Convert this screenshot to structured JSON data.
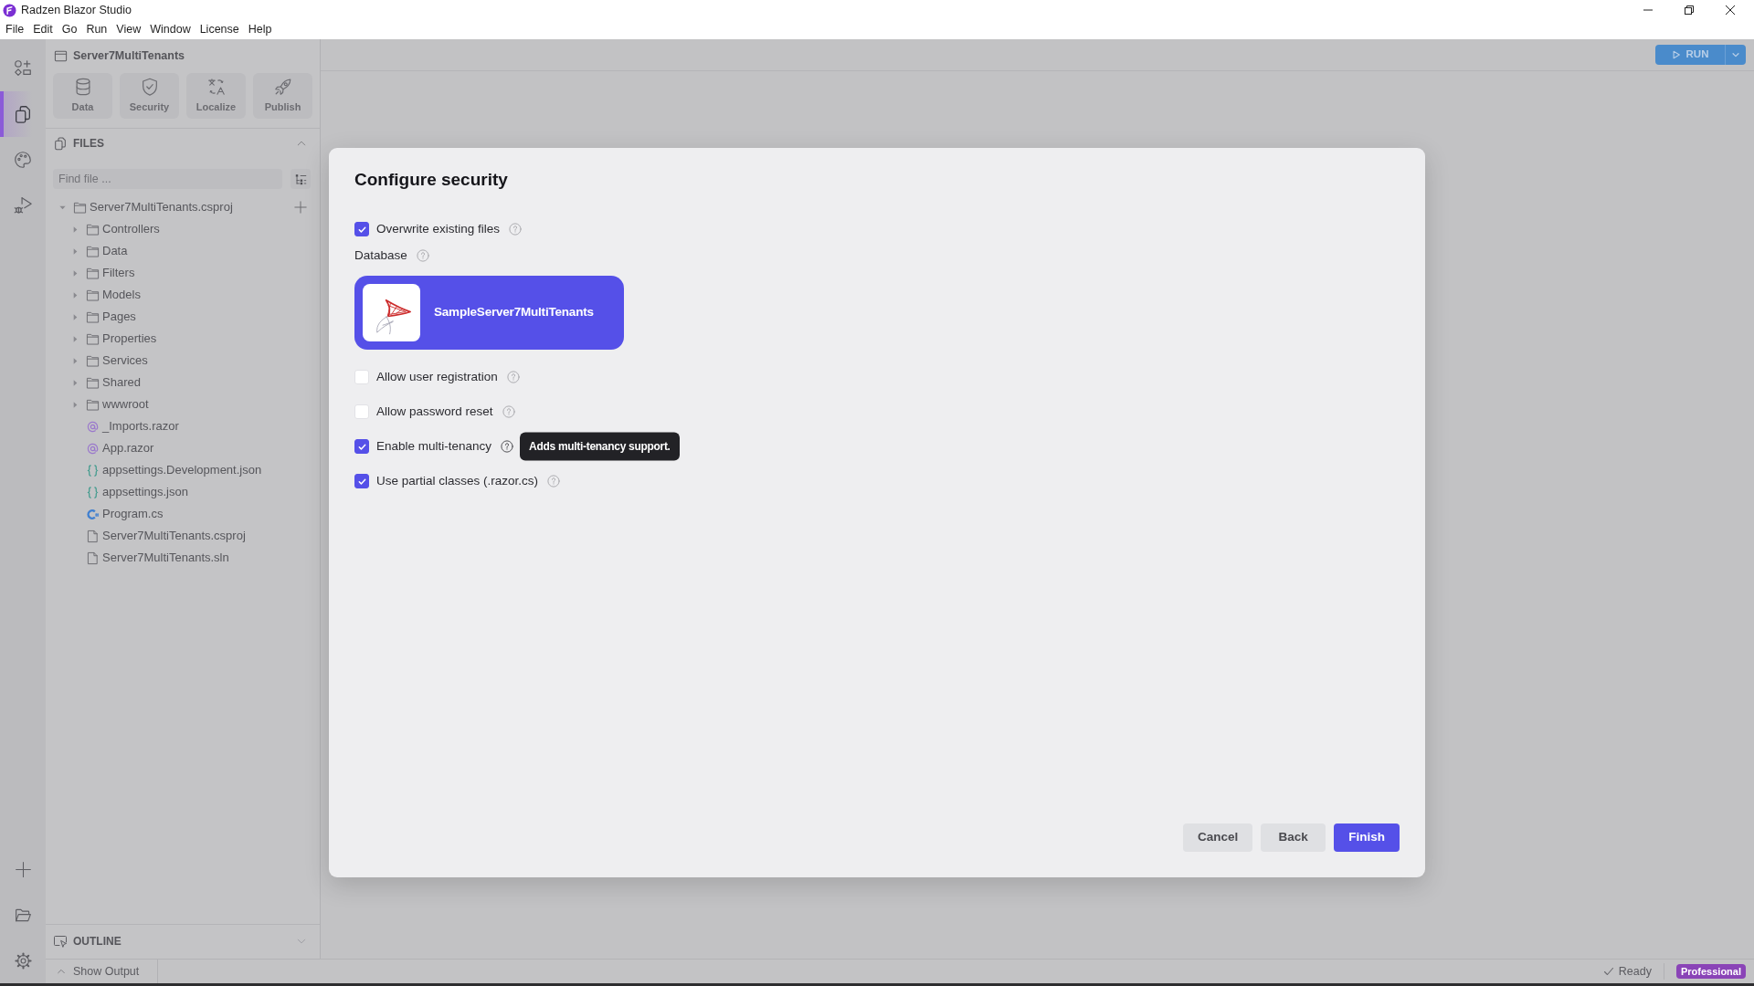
{
  "window": {
    "title": "Radzen Blazor Studio"
  },
  "menu": [
    "File",
    "Edit",
    "Go",
    "Run",
    "View",
    "Window",
    "License",
    "Help"
  ],
  "activity_bar": [
    {
      "kind": "shapes",
      "selected": false
    },
    {
      "kind": "files",
      "selected": true
    },
    {
      "kind": "palette",
      "selected": false
    },
    {
      "kind": "debug",
      "selected": false
    }
  ],
  "project": {
    "name": "Server7MultiTenants",
    "tools": [
      {
        "kind": "data",
        "label": "Data"
      },
      {
        "kind": "security",
        "label": "Security"
      },
      {
        "kind": "localize",
        "label": "Localize"
      },
      {
        "kind": "publish",
        "label": "Publish"
      }
    ]
  },
  "files_panel": {
    "title": "FILES",
    "expanded": true,
    "search": {
      "placeholder": "Find file ..."
    },
    "tree": [
      {
        "label": "Server7MultiTenants.csproj",
        "kind": "folder",
        "expanded": true,
        "children": [
          {
            "label": "Controllers",
            "kind": "folder",
            "expanded": false
          },
          {
            "label": "Data",
            "kind": "folder",
            "expanded": false
          },
          {
            "label": "Filters",
            "kind": "folder",
            "expanded": false
          },
          {
            "label": "Models",
            "kind": "folder",
            "expanded": false
          },
          {
            "label": "Pages",
            "kind": "folder",
            "expanded": false
          },
          {
            "label": "Properties",
            "kind": "folder",
            "expanded": false
          },
          {
            "label": "Services",
            "kind": "folder",
            "expanded": false
          },
          {
            "label": "Shared",
            "kind": "folder",
            "expanded": false
          },
          {
            "label": "wwwroot",
            "kind": "folder",
            "expanded": false
          },
          {
            "label": "_Imports.razor",
            "kind": "razor"
          },
          {
            "label": "App.razor",
            "kind": "razor"
          },
          {
            "label": "appsettings.Development.json",
            "kind": "json"
          },
          {
            "label": "appsettings.json",
            "kind": "json"
          },
          {
            "label": "Program.cs",
            "kind": "csharp"
          },
          {
            "label": "Server7MultiTenants.csproj",
            "kind": "file"
          },
          {
            "label": "Server7MultiTenants.sln",
            "kind": "file"
          }
        ]
      }
    ]
  },
  "outline_panel": {
    "title": "OUTLINE",
    "expanded": false
  },
  "toolbar": {
    "run_button": "RUN"
  },
  "dialog": {
    "title": "Configure security",
    "fields": [
      {
        "kind": "checkbox",
        "label": "Overwrite existing files",
        "checked": true
      },
      {
        "kind": "database",
        "label": "Database",
        "databases": [
          {
            "name": "SampleServer7MultiTenants",
            "selected": true
          }
        ]
      },
      {
        "kind": "checkbox",
        "label": "Allow user registration",
        "checked": false
      },
      {
        "kind": "checkbox",
        "label": "Allow password reset",
        "checked": false
      },
      {
        "kind": "checkbox",
        "label": "Enable multi-tenancy",
        "checked": true,
        "tooltip": "Adds multi-tenancy support."
      },
      {
        "kind": "checkbox",
        "label": "Use partial classes (.razor.cs)",
        "checked": true
      }
    ],
    "buttons": [
      {
        "label": "Cancel",
        "kind": "secondary"
      },
      {
        "label": "Back",
        "kind": "secondary"
      },
      {
        "label": "Finish",
        "kind": "primary"
      }
    ]
  },
  "status_bar": {
    "output_toggle": "Show Output",
    "status": "Ready",
    "edition": "Professional"
  }
}
